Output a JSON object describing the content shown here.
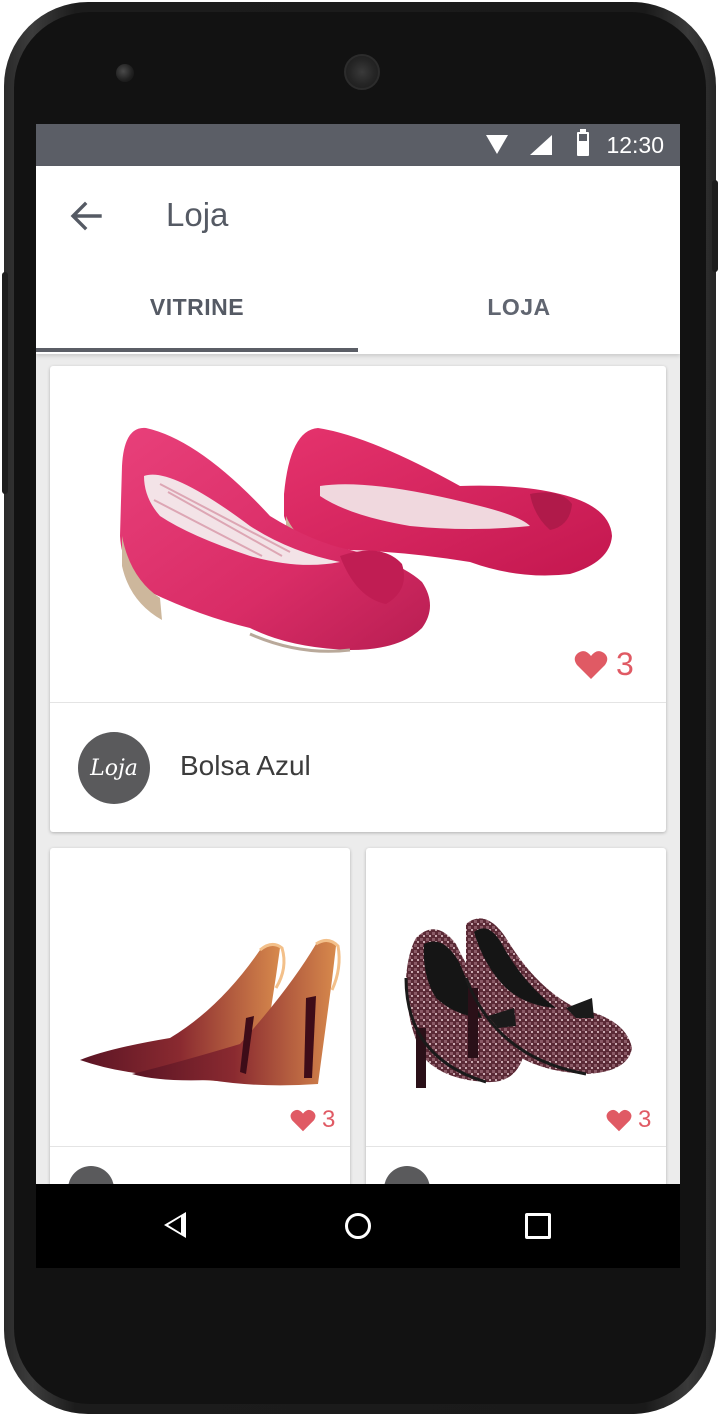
{
  "status_bar": {
    "time": "12:30"
  },
  "app_bar": {
    "title": "Loja"
  },
  "tabs": [
    {
      "label": "VITRINE",
      "selected": true
    },
    {
      "label": "LOJA",
      "selected": false
    }
  ],
  "colors": {
    "accent": "#5b5e66",
    "like": "#e05a64",
    "text": "#555a64"
  },
  "cards": [
    {
      "likes": "3",
      "store_name": "Bolsa Azul",
      "avatar_text": "Loja",
      "product_image": "pink peep-toe wedge shoes"
    },
    {
      "likes": "3",
      "product_image": "burgundy patent high heel pumps"
    },
    {
      "likes": "3",
      "product_image": "tweed heels with black bow"
    }
  ],
  "nav_bar": {
    "icons": [
      "back-icon",
      "home-icon",
      "recent-apps-icon"
    ]
  }
}
